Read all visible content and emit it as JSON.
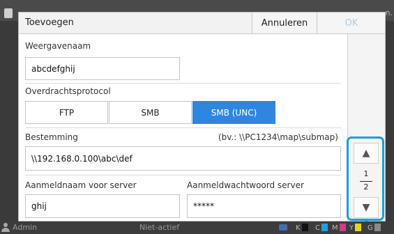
{
  "background": {
    "right_text": "n."
  },
  "dialog": {
    "title": "Toevoegen",
    "cancel_label": "Annuleren",
    "ok_label": "OK"
  },
  "display_name": {
    "label": "Weergavenaam",
    "value": "abcdefghij"
  },
  "protocol": {
    "label": "Overdrachtsprotocol",
    "options": [
      "FTP",
      "SMB",
      "SMB (UNC)"
    ],
    "selected": "SMB (UNC)"
  },
  "destination": {
    "label": "Bestemming",
    "hint": "(bv.: \\\\PC1234\\map\\submap)",
    "value": "\\\\192.168.0.100\\abc\\def"
  },
  "login_name": {
    "label": "Aanmeldnaam voor server",
    "value": "ghij"
  },
  "login_password": {
    "label": "Aanmeldwachtwoord server",
    "value": "*****"
  },
  "pagination": {
    "current": "1",
    "total": "2"
  },
  "status_bar": {
    "user": "Admin",
    "state": "Niet-actief",
    "ink_labels": [
      "K",
      "C",
      "M",
      "Y",
      "G"
    ]
  },
  "colors": {
    "accent": "#2f86e0",
    "highlight": "#18a0d6",
    "ink_k": "#111111",
    "ink_c": "#1aa3dd",
    "ink_m": "#d23a8a",
    "ink_y": "#e8d21c",
    "ink_g": "#8a8a8a"
  },
  "icons": {
    "up": "triangle-up-icon",
    "down": "triangle-down-icon",
    "user": "user-icon"
  }
}
